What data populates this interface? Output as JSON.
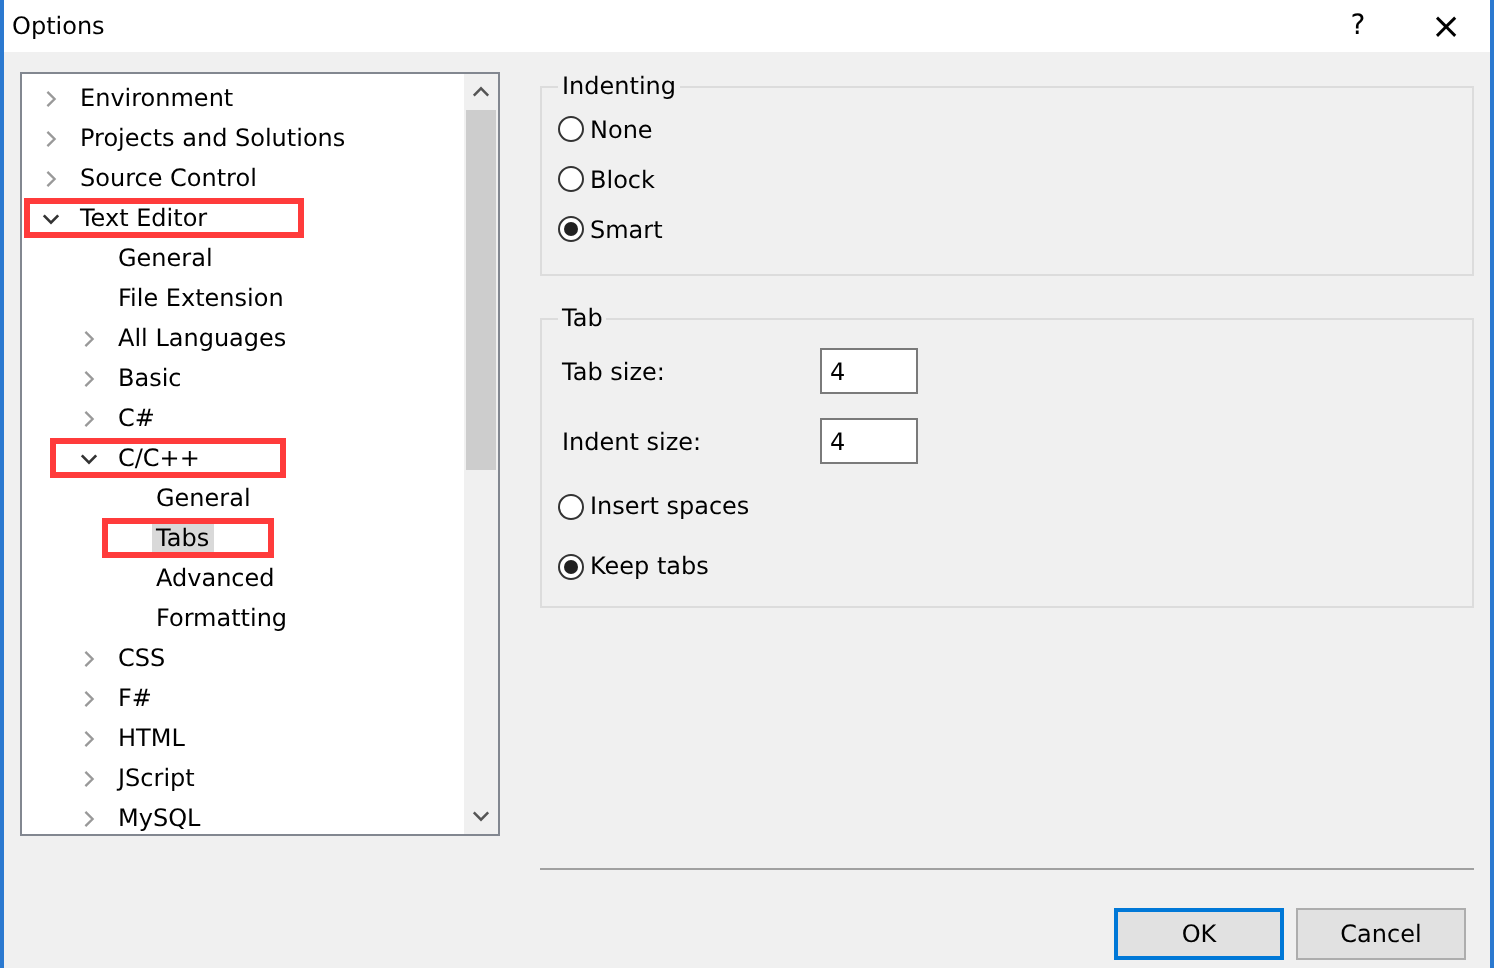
{
  "window": {
    "title": "Options",
    "help": "?",
    "close": "×"
  },
  "tree": [
    {
      "label": "Environment",
      "expanded": false,
      "has_children": true,
      "selected": false,
      "highlighted": false
    },
    {
      "label": "Projects and Solutions",
      "expanded": false,
      "has_children": true,
      "selected": false,
      "highlighted": false
    },
    {
      "label": "Source Control",
      "expanded": false,
      "has_children": true,
      "selected": false,
      "highlighted": false
    },
    {
      "label": "Text Editor",
      "expanded": true,
      "has_children": true,
      "selected": false,
      "highlighted": true,
      "children": [
        {
          "label": "General",
          "has_children": false,
          "selected": false,
          "highlighted": false
        },
        {
          "label": "File Extension",
          "has_children": false,
          "selected": false,
          "highlighted": false
        },
        {
          "label": "All Languages",
          "expanded": false,
          "has_children": true,
          "selected": false,
          "highlighted": false
        },
        {
          "label": "Basic",
          "expanded": false,
          "has_children": true,
          "selected": false,
          "highlighted": false
        },
        {
          "label": "C#",
          "expanded": false,
          "has_children": true,
          "selected": false,
          "highlighted": false
        },
        {
          "label": "C/C++",
          "expanded": true,
          "has_children": true,
          "selected": false,
          "highlighted": true,
          "children": [
            {
              "label": "General",
              "has_children": false,
              "selected": false,
              "highlighted": false
            },
            {
              "label": "Tabs",
              "has_children": false,
              "selected": true,
              "highlighted": true
            },
            {
              "label": "Advanced",
              "has_children": false,
              "selected": false,
              "highlighted": false
            },
            {
              "label": "Formatting",
              "has_children": false,
              "selected": false,
              "highlighted": false
            }
          ]
        },
        {
          "label": "CSS",
          "expanded": false,
          "has_children": true,
          "selected": false,
          "highlighted": false
        },
        {
          "label": "F#",
          "expanded": false,
          "has_children": true,
          "selected": false,
          "highlighted": false
        },
        {
          "label": "HTML",
          "expanded": false,
          "has_children": true,
          "selected": false,
          "highlighted": false
        },
        {
          "label": "JScript",
          "expanded": false,
          "has_children": true,
          "selected": false,
          "highlighted": false
        },
        {
          "label": "MySQL",
          "expanded": false,
          "has_children": true,
          "selected": false,
          "highlighted": false
        }
      ]
    }
  ],
  "indenting": {
    "title": "Indenting",
    "options": [
      {
        "label": "None",
        "selected": false
      },
      {
        "label": "Block",
        "selected": false
      },
      {
        "label": "Smart",
        "selected": true
      }
    ]
  },
  "tab": {
    "title": "Tab",
    "fields": [
      {
        "label": "Tab size:",
        "value": "4"
      },
      {
        "label": "Indent size:",
        "value": "4"
      }
    ],
    "options": [
      {
        "label": "Insert spaces",
        "selected": false
      },
      {
        "label": "Keep tabs",
        "selected": true
      }
    ]
  },
  "buttons": [
    {
      "label": "OK",
      "default": true
    },
    {
      "label": "Cancel",
      "default": false
    }
  ]
}
